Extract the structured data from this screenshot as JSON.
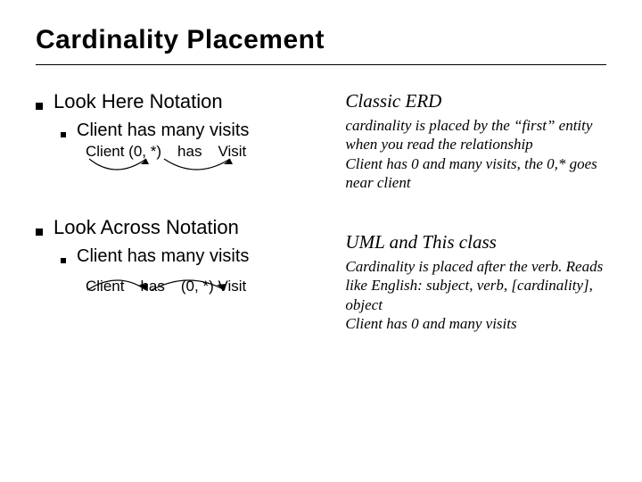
{
  "title": "Cardinality Placement",
  "left": {
    "sec1": {
      "heading": "Look Here Notation",
      "sub": "Client has many visits",
      "diagram": {
        "a": "Client (0, *)",
        "b": "has",
        "c": "Visit"
      }
    },
    "sec2": {
      "heading": "Look Across Notation",
      "sub": "Client has many visits",
      "diagram": {
        "a": "Client",
        "b": "has",
        "c": "(0, *) Visit"
      }
    }
  },
  "right": {
    "sec1": {
      "heading": "Classic ERD",
      "body": "cardinality is placed by the “first” entity when you read the relationship\nClient has 0 and many visits, the 0,* goes near client"
    },
    "sec2": {
      "heading": "UML and This class",
      "body": "Cardinality is placed after the verb. Reads like English: subject, verb, [cardinality], object\nClient has 0 and many visits"
    }
  }
}
